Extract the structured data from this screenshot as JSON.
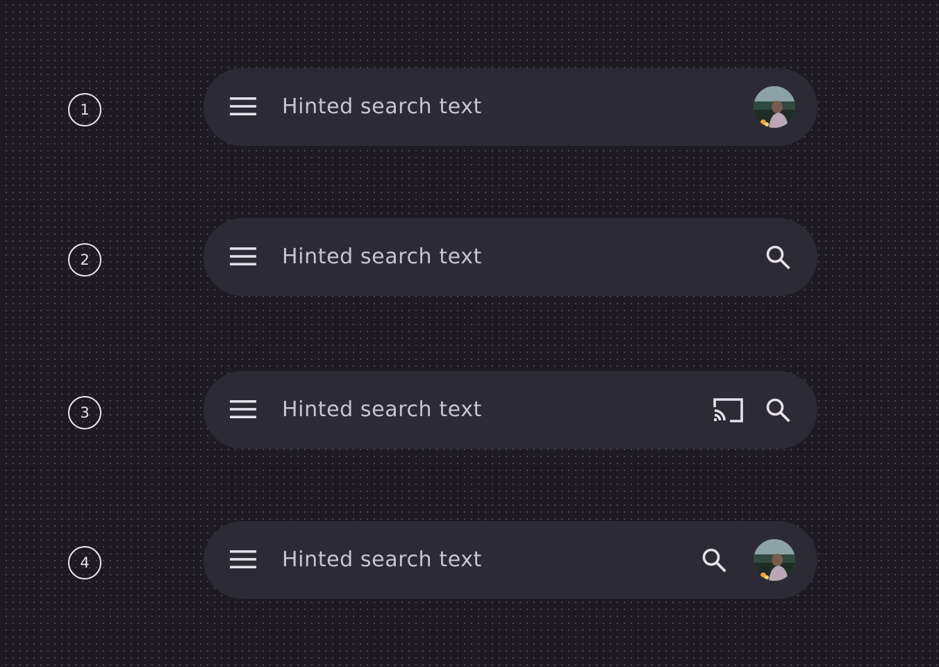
{
  "variants": [
    {
      "marker": "1",
      "search": {
        "hint": "Hinted search text"
      },
      "trailing": [
        "avatar"
      ]
    },
    {
      "marker": "2",
      "search": {
        "hint": "Hinted search text"
      },
      "trailing": [
        "search-icon"
      ]
    },
    {
      "marker": "3",
      "search": {
        "hint": "Hinted search text"
      },
      "trailing": [
        "cast-icon",
        "search-icon"
      ]
    },
    {
      "marker": "4",
      "search": {
        "hint": "Hinted search text"
      },
      "trailing": [
        "search-icon",
        "avatar"
      ]
    }
  ],
  "icons": {
    "leading": "menu-icon"
  },
  "colors": {
    "background": "#1d1b21",
    "bar_surface": "#2c2a34",
    "icon": "#e6e1e9",
    "hint_text": "#c8c5ce",
    "marker": "#e8e6ea"
  }
}
